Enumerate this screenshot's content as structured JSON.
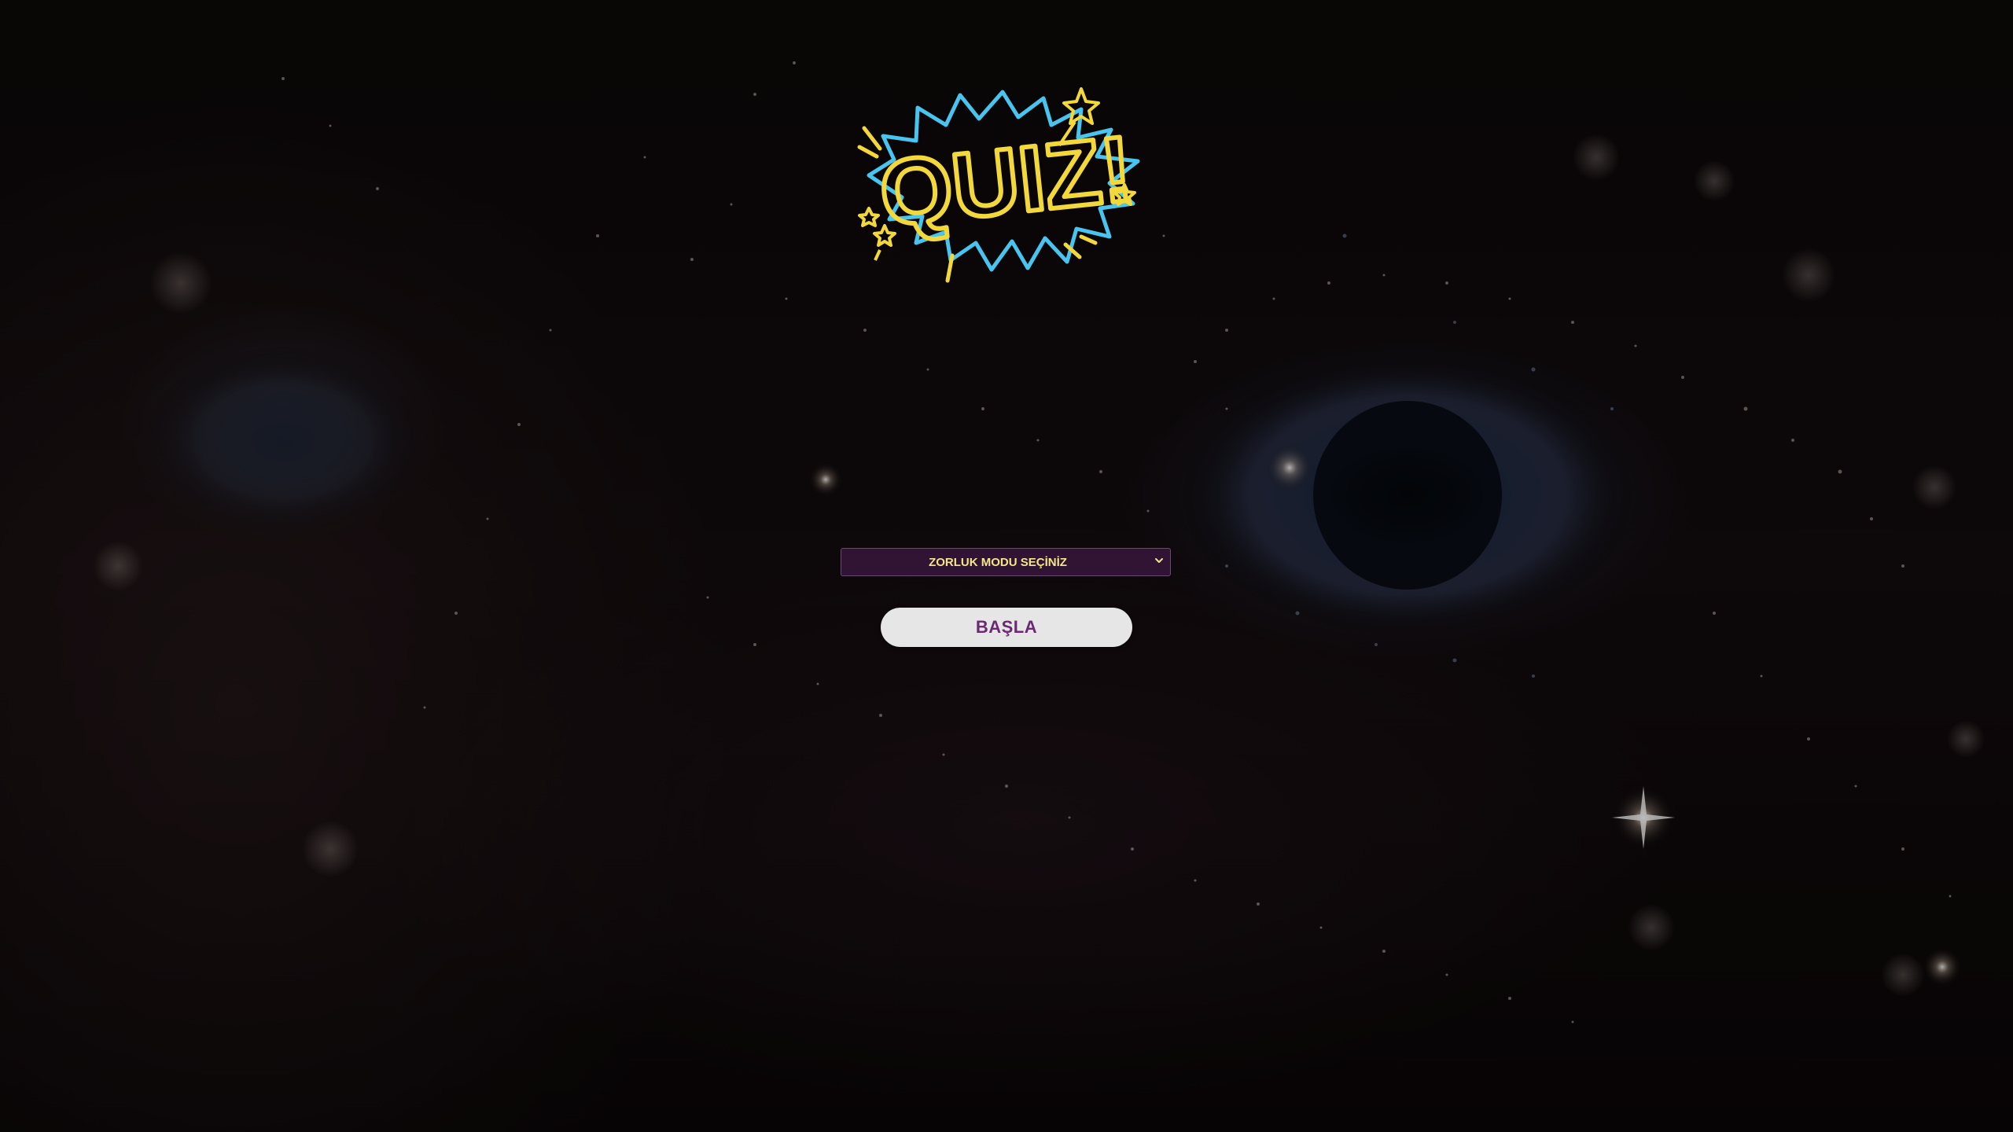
{
  "logo": {
    "text": "QUIZ!",
    "icon": "quiz-burst-logo",
    "colors": {
      "burst_outline": "#48c4ee",
      "text": "#f2d83a",
      "sparks": "#f2d83a"
    }
  },
  "difficulty": {
    "selected": "ZORLUK MODU SEÇİNİZ",
    "icon": "chevron-down-icon",
    "background": "#311333",
    "text_color": "#f2e68a"
  },
  "start_button": {
    "label": "BAŞLA",
    "background": "#e6e6e6",
    "text_color": "#6a2a72"
  },
  "background": {
    "description_icon": "starry-face-backdrop"
  }
}
